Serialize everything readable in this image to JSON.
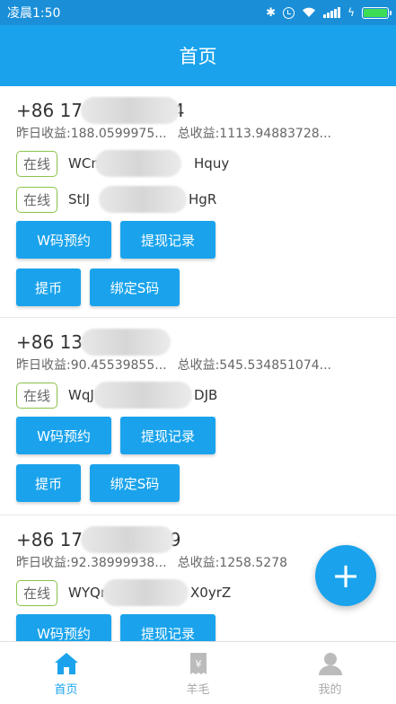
{
  "status_bar": {
    "time": "凌晨1:50",
    "icons": [
      "bluetooth-icon",
      "alarm-icon",
      "wifi-icon",
      "signal-icon",
      "charging-icon",
      "battery-icon"
    ]
  },
  "header": {
    "title": "首页"
  },
  "accounts": [
    {
      "phone_prefix": "+86",
      "phone_start": "17",
      "phone_end": "14",
      "yesterday": "昨日收益:188.0599975...",
      "total": "总收益:1113.94883728...",
      "devices": [
        {
          "status": "在线",
          "id_start": "WCm",
          "id_end": "Hquy"
        },
        {
          "status": "在线",
          "id_start": "StlJ",
          "id_end": "HgR"
        }
      ],
      "buttons": {
        "w_reserve": "W码预约",
        "withdraw_record": "提现记录",
        "withdraw": "提币",
        "bind_s": "绑定S码"
      }
    },
    {
      "phone_prefix": "+86",
      "phone_start": "13",
      "phone_end": "4",
      "yesterday": "昨日收益:90.45539855...",
      "total": "总收益:545.534851074...",
      "devices": [
        {
          "status": "在线",
          "id_start": "WqJ",
          "id_end": "DJB"
        }
      ],
      "buttons": {
        "w_reserve": "W码预约",
        "withdraw_record": "提现记录",
        "withdraw": "提币",
        "bind_s": "绑定S码"
      }
    },
    {
      "phone_prefix": "+86",
      "phone_start": "17",
      "phone_end": "39",
      "yesterday": "昨日收益:92.38999938...",
      "total": "总收益:1258.5278",
      "devices": [
        {
          "status": "在线",
          "id_start": "WYQr",
          "id_end": "X0yrZ"
        }
      ],
      "buttons": {
        "w_reserve": "W码预约",
        "withdraw_record": "提现记录"
      }
    }
  ],
  "fab": {
    "label": "+"
  },
  "bottom_nav": {
    "items": [
      {
        "label": "首页",
        "icon": "home-icon",
        "active": true
      },
      {
        "label": "羊毛",
        "icon": "receipt-icon",
        "active": false
      },
      {
        "label": "我的",
        "icon": "user-icon",
        "active": false
      }
    ]
  },
  "colors": {
    "primary": "#1aa3ec",
    "status_bar": "#1a8fd8",
    "online_border": "#8bc34a"
  }
}
